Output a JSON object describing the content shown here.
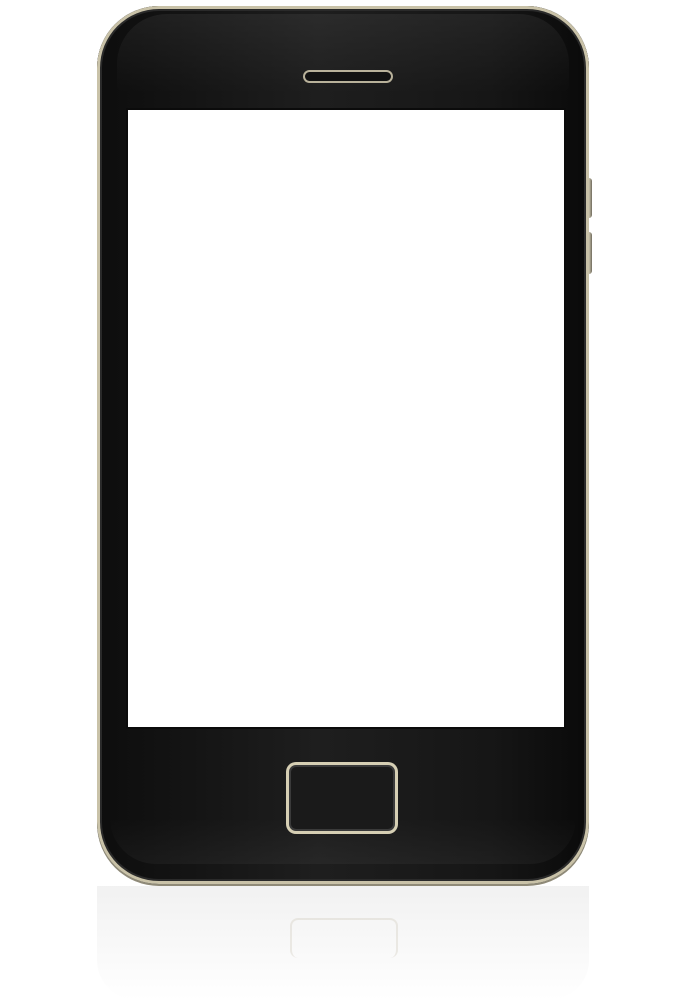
{
  "scene": {
    "description_free": true,
    "colors": {
      "background": "#ffffff",
      "phone_body": "#161616",
      "trim": "#c9c2a8",
      "screen": "#ffffff"
    },
    "icons": {
      "speaker": "speaker-grille-icon",
      "home": "home-button-icon"
    }
  }
}
